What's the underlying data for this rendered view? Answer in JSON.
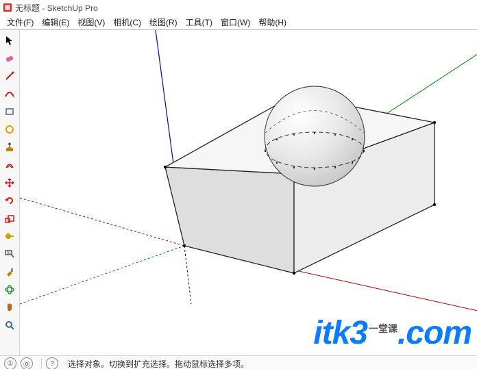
{
  "title": "无标题 - SketchUp Pro",
  "menus": [
    "文件(F)",
    "编辑(E)",
    "视图(V)",
    "相机(C)",
    "绘图(R)",
    "工具(T)",
    "窗口(W)",
    "帮助(H)"
  ],
  "tools": [
    {
      "name": "select-tool",
      "color": "#000"
    },
    {
      "name": "eraser-tool",
      "color": "#e85f9a"
    },
    {
      "name": "line-tool",
      "color": "#c61b1b"
    },
    {
      "name": "arc-tool",
      "color": "#c61b1b"
    },
    {
      "name": "rectangle-tool",
      "color": "#7a8a99"
    },
    {
      "name": "circle-tool",
      "color": "#e6a100"
    },
    {
      "name": "pushpull-tool",
      "color": "#b58b00"
    },
    {
      "name": "offset-tool",
      "color": "#c61b1b"
    },
    {
      "name": "move-tool",
      "color": "#c61b1b"
    },
    {
      "name": "rotate-tool",
      "color": "#c61b1b"
    },
    {
      "name": "scale-tool",
      "color": "#c61b1b"
    },
    {
      "name": "tape-tool",
      "color": "#c9a500"
    },
    {
      "name": "text-tool",
      "color": "#3a3a3a"
    },
    {
      "name": "paint-tool",
      "color": "#b58b00"
    },
    {
      "name": "orbit-tool",
      "color": "#2a9d3c"
    },
    {
      "name": "pan-tool",
      "color": "#b5651d"
    },
    {
      "name": "zoom-tool",
      "color": "#3a6ea5"
    }
  ],
  "status": {
    "icons": [
      "①",
      "⓪",
      "?"
    ],
    "text": "选择对象。切换到扩充选择。拖动鼠标选择多项。"
  },
  "watermark": {
    "brand": "itk3",
    "ext": ".com",
    "tag": "一堂课"
  },
  "scene": {
    "axes": {
      "x": "#b00000",
      "y": "#008800",
      "z": "#0000b0"
    },
    "box": true,
    "sphere": true
  }
}
